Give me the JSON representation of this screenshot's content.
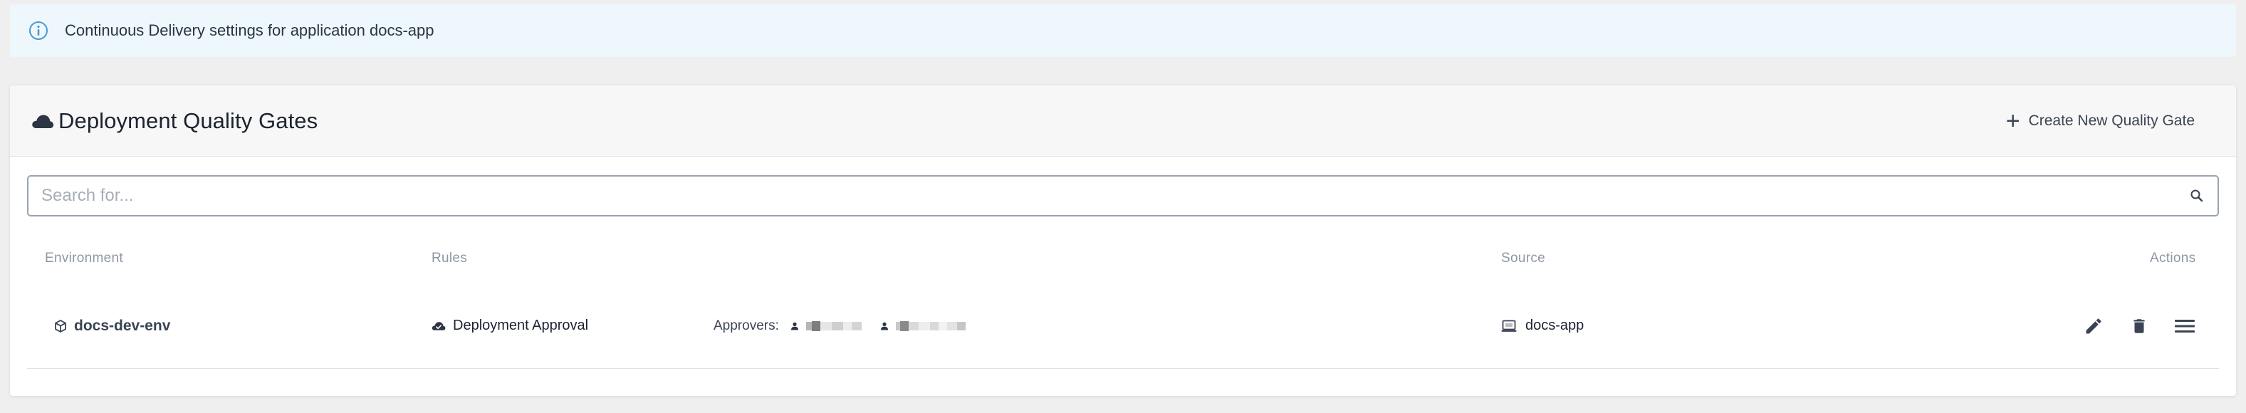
{
  "banner": {
    "text": "Continuous Delivery settings for application docs-app",
    "icon": "info-icon"
  },
  "card": {
    "title": "Deployment Quality Gates",
    "title_icon": "cloud-icon",
    "create_button_label": "Create New Quality Gate"
  },
  "search": {
    "placeholder": "Search for...",
    "value": ""
  },
  "table": {
    "columns": {
      "environment": "Environment",
      "rules": "Rules",
      "source": "Source",
      "actions": "Actions"
    },
    "rows": [
      {
        "environment": "docs-dev-env",
        "rule": "Deployment Approval",
        "approvers_label": "Approvers:",
        "approvers_count": 2,
        "source": "docs-app",
        "actions": [
          "edit",
          "delete",
          "menu"
        ]
      }
    ]
  },
  "colors": {
    "banner_bg": "#eef7fb",
    "info_blue": "#4a9ad6",
    "text_dark": "#1b2330",
    "muted": "#8f97a3"
  }
}
